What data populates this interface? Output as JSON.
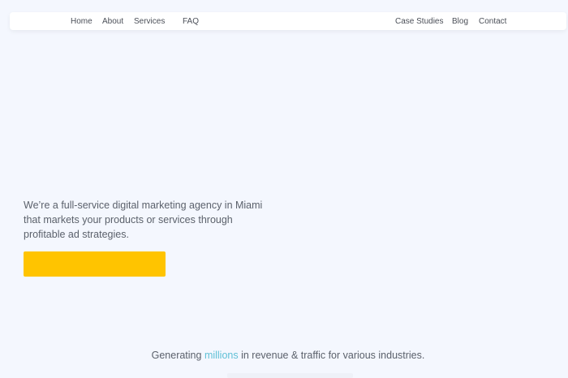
{
  "nav": {
    "left_links": [
      "Home",
      "About",
      "Services",
      "FAQ"
    ],
    "right_links": [
      "Case Studies",
      "Blog",
      "Contact"
    ]
  },
  "hero": {
    "description": "We’re a full-service digital marketing agency in Miami that markets your products or services through profitable ad strategies.",
    "cta_label": ""
  },
  "tagline": {
    "prefix": "Generating ",
    "highlight": "millions",
    "suffix": " in revenue & traffic for various industries."
  },
  "colors": {
    "background": "#f4f7fe",
    "cta": "#ffc400",
    "highlight": "#5fc0d6",
    "text": "#5b616b"
  }
}
